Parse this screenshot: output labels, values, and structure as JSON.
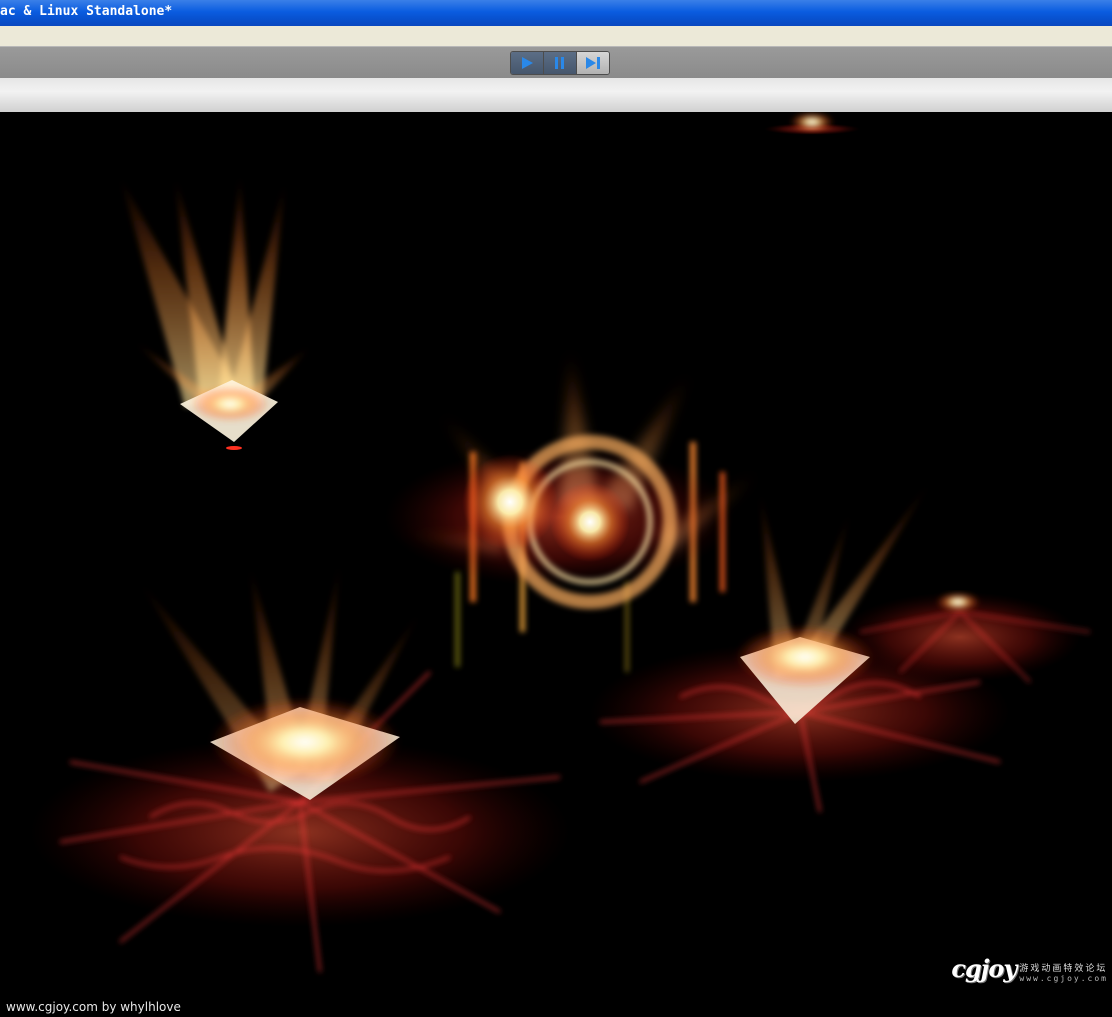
{
  "window": {
    "title": "ac & Linux Standalone*"
  },
  "toolbar": {
    "play": {
      "icon": "play-icon",
      "glyph": "▶",
      "state": "active"
    },
    "pause": {
      "icon": "pause-icon",
      "glyph": "❚❚",
      "state": "active"
    },
    "step": {
      "icon": "step-forward-icon",
      "glyph": "▶▏",
      "state": "inactive"
    }
  },
  "viewport": {
    "background": "#000000",
    "effect_colors": {
      "core": "#fffbe0",
      "flame": "#ff9a3c",
      "crack": "#ff3b3b"
    }
  },
  "watermark": {
    "credit": "www.cgjoy.com by whylhlove",
    "logo": "cgjoy",
    "logo_subtitle": "游戏动画特效论坛",
    "logo_url": "www.cgjoy.com"
  }
}
